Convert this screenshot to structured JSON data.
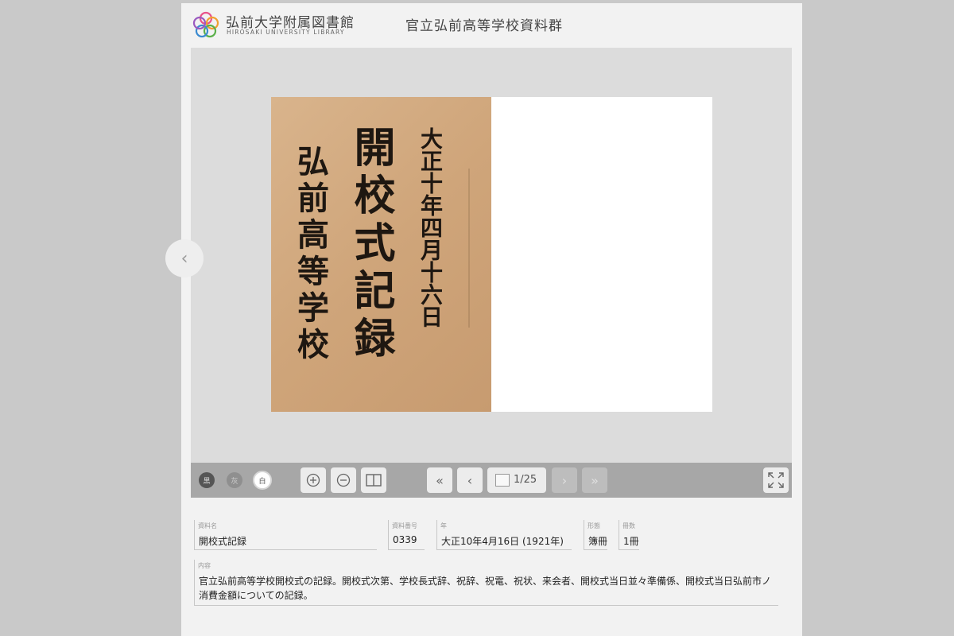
{
  "header": {
    "library_name": "弘前大学附属図書館",
    "library_name_en": "HIROSAKI UNIVERSITY LIBRARY",
    "collection_title": "官立弘前高等学校資料群"
  },
  "document_image": {
    "col_date": "大正十年四月十六日",
    "col_title": "開校式記録",
    "col_school": "弘前高等学校"
  },
  "toolbar": {
    "bg_dark_label": "黒",
    "bg_gray_label": "灰",
    "bg_white_label": "白",
    "current_page": "1/25",
    "icons": [
      "zoom-in-icon",
      "zoom-out-icon",
      "spread-view-icon",
      "first-page-icon",
      "prev-page-icon",
      "next-page-icon",
      "last-page-icon",
      "fullscreen-icon"
    ]
  },
  "fields": {
    "title": {
      "label": "資料名",
      "value": "開校式記録"
    },
    "number": {
      "label": "資料番号",
      "value": "0339"
    },
    "year": {
      "label": "年",
      "value": "大正10年4月16日 (1921年)"
    },
    "form": {
      "label": "形態",
      "value": "簿冊"
    },
    "count": {
      "label": "冊数",
      "value": "1冊"
    },
    "content": {
      "label": "内容",
      "value": "官立弘前高等学校開校式の記録。開校式次第、学校長式辞、祝辞、祝電、祝状、来会者、開校式当日並々準備係、開校式当日弘前市ノ消費金額についての記録。"
    }
  },
  "colors": {
    "page_bg": "#c9c9c9",
    "panel_bg": "#f2f2f2",
    "viewer_bg": "#dcdcdc",
    "toolbar_bg": "#a7a7a7"
  }
}
